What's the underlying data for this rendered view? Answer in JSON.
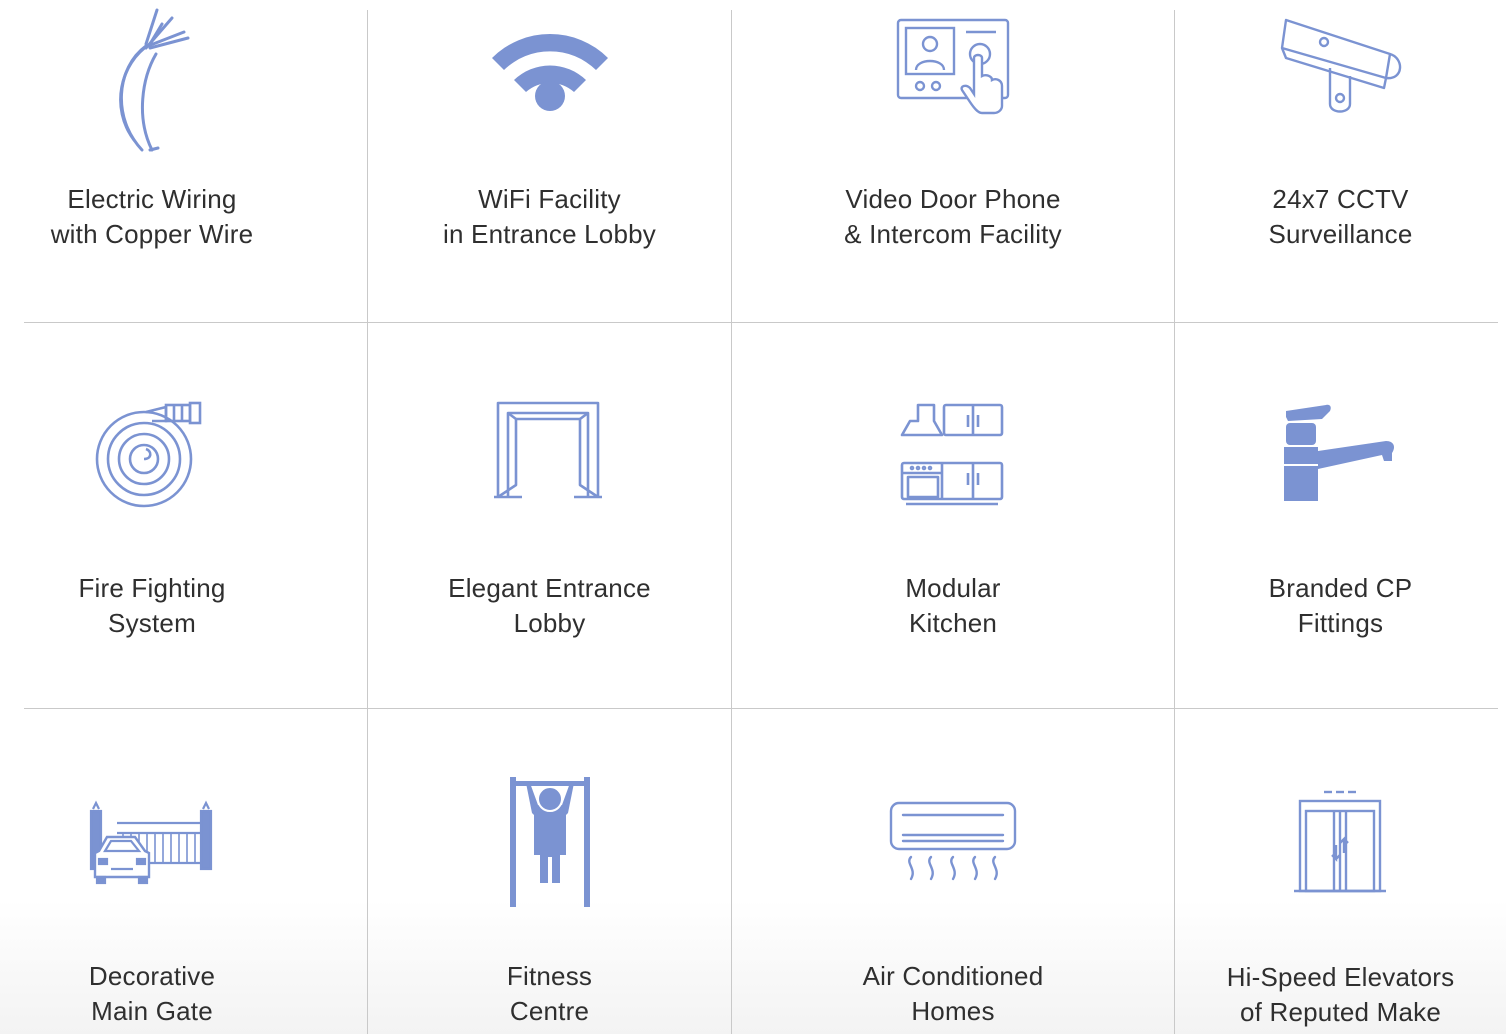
{
  "accent_color": "#7b93d2",
  "amenities": [
    {
      "icon": "copper-wire-icon",
      "line1": "Electric Wiring",
      "line2": "with Copper Wire"
    },
    {
      "icon": "wifi-icon",
      "line1": "WiFi Facility",
      "line2": "in Entrance Lobby"
    },
    {
      "icon": "video-door-phone-icon",
      "line1": "Video Door Phone",
      "line2": "& Intercom Facility"
    },
    {
      "icon": "cctv-camera-icon",
      "line1": "24x7 CCTV",
      "line2": "Surveillance"
    },
    {
      "icon": "fire-hose-icon",
      "line1": "Fire Fighting",
      "line2": "System"
    },
    {
      "icon": "entrance-doorway-icon",
      "line1": "Elegant Entrance",
      "line2": "Lobby"
    },
    {
      "icon": "modular-kitchen-icon",
      "line1": "Modular",
      "line2": "Kitchen"
    },
    {
      "icon": "faucet-icon",
      "line1": "Branded CP",
      "line2": "Fittings"
    },
    {
      "icon": "main-gate-icon",
      "line1": "Decorative",
      "line2": "Main Gate"
    },
    {
      "icon": "pull-up-bar-icon",
      "line1": "Fitness",
      "line2": "Centre"
    },
    {
      "icon": "air-conditioner-icon",
      "line1": "Air Conditioned",
      "line2": "Homes"
    },
    {
      "icon": "elevator-icon",
      "line1": "Hi-Speed Elevators",
      "line2": "of Reputed Make"
    }
  ]
}
